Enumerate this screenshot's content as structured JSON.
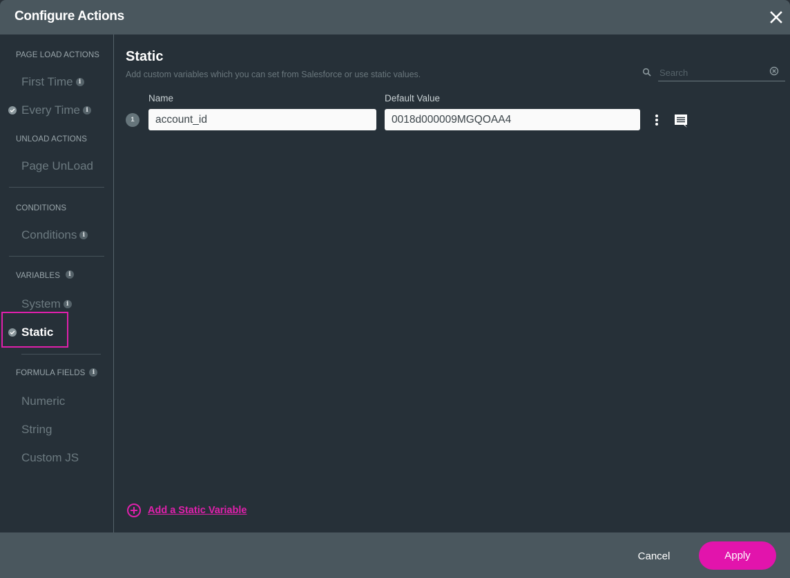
{
  "dialog": {
    "title": "Configure Actions",
    "close_icon": "close-icon"
  },
  "sidebar": {
    "sections": [
      {
        "label": "PAGE LOAD ACTIONS",
        "info": false
      },
      {
        "label": "UNLOAD ACTIONS",
        "info": false
      },
      {
        "label": "CONDITIONS",
        "info": false
      },
      {
        "label": "VARIABLES",
        "info": true
      },
      {
        "label": "FORMULA FIELDS",
        "info": true
      }
    ],
    "items": [
      {
        "label": "First Time",
        "info": true,
        "checked": false,
        "active": false
      },
      {
        "label": "Every Time",
        "info": true,
        "checked": true,
        "active": false
      },
      {
        "label": "Page UnLoad",
        "info": false,
        "checked": false,
        "active": false
      },
      {
        "label": "Conditions",
        "info": true,
        "checked": false,
        "active": false
      },
      {
        "label": "System",
        "info": true,
        "checked": false,
        "active": false
      },
      {
        "label": "Static",
        "info": false,
        "checked": true,
        "active": true
      },
      {
        "label": "Numeric",
        "info": false,
        "checked": false,
        "active": false
      },
      {
        "label": "String",
        "info": false,
        "checked": false,
        "active": false
      },
      {
        "label": "Custom JS",
        "info": false,
        "checked": false,
        "active": false
      }
    ],
    "info_glyph": "i"
  },
  "main": {
    "title": "Static",
    "subtitle": "Add custom variables which you can set from Salesforce or use static values.",
    "search": {
      "placeholder": "Search",
      "value": ""
    },
    "columns": {
      "name": "Name",
      "default_value": "Default Value"
    },
    "rows": [
      {
        "index": "1",
        "name": "account_id",
        "default_value": "0018d000009MGQOAA4"
      }
    ],
    "add_link": "Add a Static Variable"
  },
  "footer": {
    "cancel": "Cancel",
    "apply": "Apply"
  },
  "colors": {
    "accent": "#e214ac",
    "header_bg": "#4a575e",
    "body_bg": "#263038"
  }
}
